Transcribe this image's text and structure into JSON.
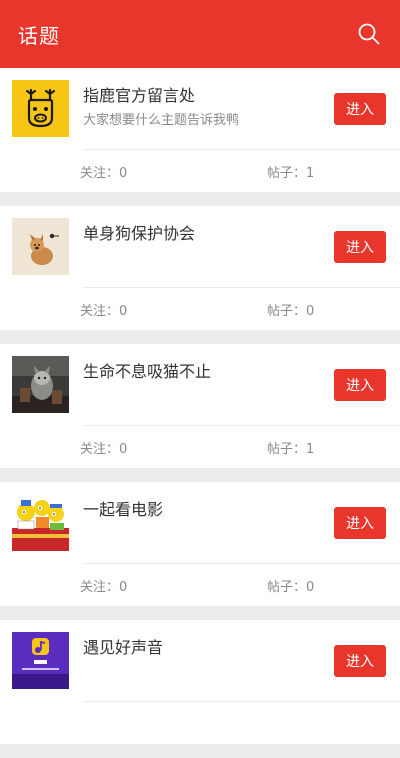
{
  "header": {
    "title": "话题",
    "search_icon": "search-icon"
  },
  "colors": {
    "accent": "#e8362d",
    "background": "#ececec"
  },
  "topics": [
    {
      "title": "指鹿官方留言处",
      "desc": "大家想要什么主题告诉我鸭",
      "enter_label": "进入",
      "follow_label": "关注：0",
      "posts_label": "帖子：1",
      "icon": "deer-logo"
    },
    {
      "title": "单身狗保护协会",
      "desc": "",
      "enter_label": "进入",
      "follow_label": "关注：0",
      "posts_label": "帖子：0",
      "icon": "dog-thumbnail"
    },
    {
      "title": "生命不息吸猫不止",
      "desc": "",
      "enter_label": "进入",
      "follow_label": "关注：0",
      "posts_label": "帖子：1",
      "icon": "cat-photo-thumbnail"
    },
    {
      "title": "一起看电影",
      "desc": "",
      "enter_label": "进入",
      "follow_label": "关注：0",
      "posts_label": "帖子：0",
      "icon": "movie-cartoon-thumbnail"
    },
    {
      "title": "遇见好声音",
      "desc": "",
      "enter_label": "进入",
      "follow_label": "",
      "posts_label": "",
      "icon": "music-app-thumbnail"
    }
  ]
}
